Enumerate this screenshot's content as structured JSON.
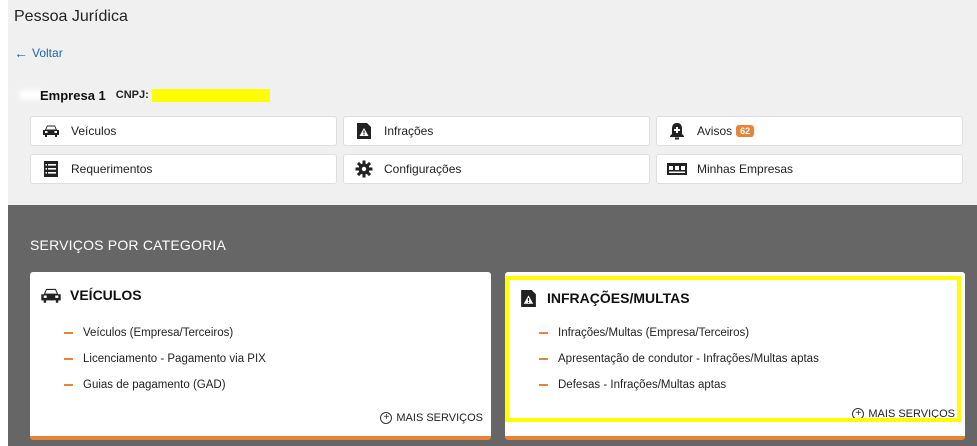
{
  "page": {
    "title": "Pessoa Jurídica",
    "back_label": "Voltar"
  },
  "company": {
    "name": "Empresa 1",
    "cnpj_label": "CNPJ:"
  },
  "nav": [
    {
      "label": "Veículos",
      "icon": "car-icon"
    },
    {
      "label": "Infrações",
      "icon": "infraction-document-icon"
    },
    {
      "label": "Avisos",
      "icon": "alert-bell-icon",
      "badge": "62"
    },
    {
      "label": "Requerimentos",
      "icon": "list-document-icon"
    },
    {
      "label": "Configurações",
      "icon": "gear-icon"
    },
    {
      "label": "Minhas Empresas",
      "icon": "company-card-icon"
    }
  ],
  "services": {
    "title": "SERVIÇOS POR CATEGORIA",
    "categories": [
      {
        "title": "VEÍCULOS",
        "icon": "car-icon",
        "items": [
          "Veículos (Empresa/Terceiros)",
          "Licenciamento - Pagamento via PIX",
          "Guias de pagamento (GAD)"
        ],
        "more_label": "MAIS SERVIÇOS"
      },
      {
        "title": "INFRAÇÕES/MULTAS",
        "icon": "infraction-document-icon",
        "items": [
          "Infrações/Multas (Empresa/Terceiros)",
          "Apresentação de condutor - Infrações/Multas aptas",
          "Defesas - Infrações/Multas aptas"
        ],
        "more_label": "MAIS SERVIÇOS"
      }
    ]
  },
  "colors": {
    "accent": "#e8843a",
    "link": "#1a64b4",
    "highlight": "#ffff00",
    "section_bg": "#666666"
  }
}
